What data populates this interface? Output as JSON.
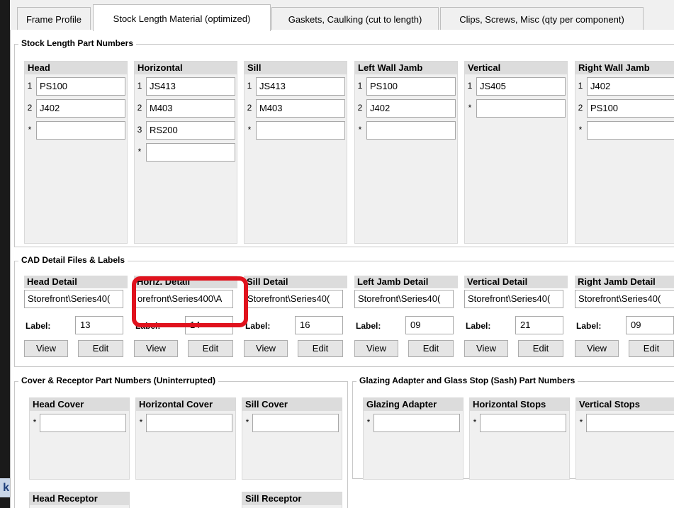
{
  "tabs": [
    "Frame Profile",
    "Stock Length Material (optimized)",
    "Gaskets, Caulking (cut to length)",
    "Clips, Screws, Misc (qty per component)"
  ],
  "active_tab": "Stock Length Material (optimized)",
  "stock_length": {
    "legend": "Stock Length Part Numbers",
    "columns": [
      {
        "header": "Head",
        "rows": [
          {
            "num": "1",
            "value": "PS100"
          },
          {
            "num": "2",
            "value": "J402"
          },
          {
            "num": "*",
            "value": ""
          }
        ]
      },
      {
        "header": "Horizontal",
        "rows": [
          {
            "num": "1",
            "value": "JS413"
          },
          {
            "num": "2",
            "value": "M403"
          },
          {
            "num": "3",
            "value": "RS200"
          },
          {
            "num": "*",
            "value": ""
          }
        ]
      },
      {
        "header": "Sill",
        "rows": [
          {
            "num": "1",
            "value": "JS413"
          },
          {
            "num": "2",
            "value": "M403"
          },
          {
            "num": "*",
            "value": ""
          }
        ]
      },
      {
        "header": "Left Wall Jamb",
        "rows": [
          {
            "num": "1",
            "value": "PS100"
          },
          {
            "num": "2",
            "value": "J402"
          },
          {
            "num": "*",
            "value": ""
          }
        ]
      },
      {
        "header": "Vertical",
        "rows": [
          {
            "num": "1",
            "value": "JS405"
          },
          {
            "num": "*",
            "value": ""
          }
        ]
      },
      {
        "header": "Right Wall Jamb",
        "rows": [
          {
            "num": "1",
            "value": "J402"
          },
          {
            "num": "2",
            "value": "PS100"
          },
          {
            "num": "*",
            "value": ""
          }
        ]
      }
    ]
  },
  "cad": {
    "legend": "CAD Detail Files & Labels",
    "label_text": "Label:",
    "view_label": "View",
    "edit_label": "Edit",
    "details": [
      {
        "header": "Head Detail",
        "file": "Storefront\\Series40(",
        "label": "13"
      },
      {
        "header": "Horiz. Detail",
        "file": "orefront\\Series400\\A",
        "label": "14"
      },
      {
        "header": "Sill Detail",
        "file": "Storefront\\Series40(",
        "label": "16"
      },
      {
        "header": "Left Jamb Detail",
        "file": "Storefront\\Series40(",
        "label": "09"
      },
      {
        "header": "Vertical Detail",
        "file": "Storefront\\Series40(",
        "label": "21"
      },
      {
        "header": "Right Jamb Detail",
        "file": "Storefront\\Series40(",
        "label": "09"
      }
    ]
  },
  "cover": {
    "legend": "Cover & Receptor Part Numbers (Uninterrupted)",
    "columns": [
      {
        "header": "Head Cover"
      },
      {
        "header": "Horizontal Cover"
      },
      {
        "header": "Sill Cover"
      }
    ],
    "receptors": [
      {
        "header": "Head Receptor"
      },
      {
        "header": "Sill Receptor"
      }
    ]
  },
  "glazing": {
    "legend": "Glazing Adapter and Glass Stop (Sash) Part Numbers",
    "columns": [
      {
        "header": "Glazing Adapter"
      },
      {
        "header": "Horizontal Stops"
      },
      {
        "header": "Vertical Stops"
      }
    ]
  },
  "left_chip": "k",
  "colors": {
    "highlight": "#e0121d",
    "panel": "#ffffff",
    "header_bg": "#dcdcdc"
  }
}
